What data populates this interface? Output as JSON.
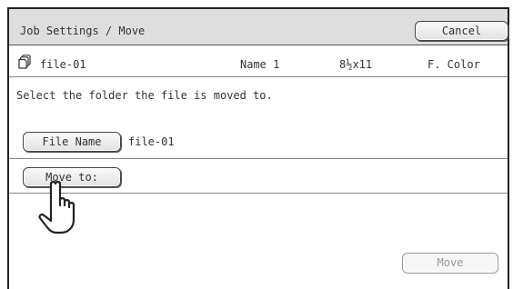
{
  "header": {
    "title": "Job Settings / Move",
    "cancel_label": "Cancel"
  },
  "file_info": {
    "icon": "file-stack-icon",
    "file_name": "file-01",
    "user": "Name 1",
    "paper_size": "8½x11",
    "color_mode": "F. Color"
  },
  "instruction": "Select the folder the file is moved to.",
  "fields": {
    "file_name_button": "File Name",
    "file_name_value": "file-01",
    "move_to_button": "Move to:"
  },
  "actions": {
    "move_label": "Move",
    "move_enabled": false
  },
  "pointer": {
    "icon": "pointing-hand-icon"
  }
}
